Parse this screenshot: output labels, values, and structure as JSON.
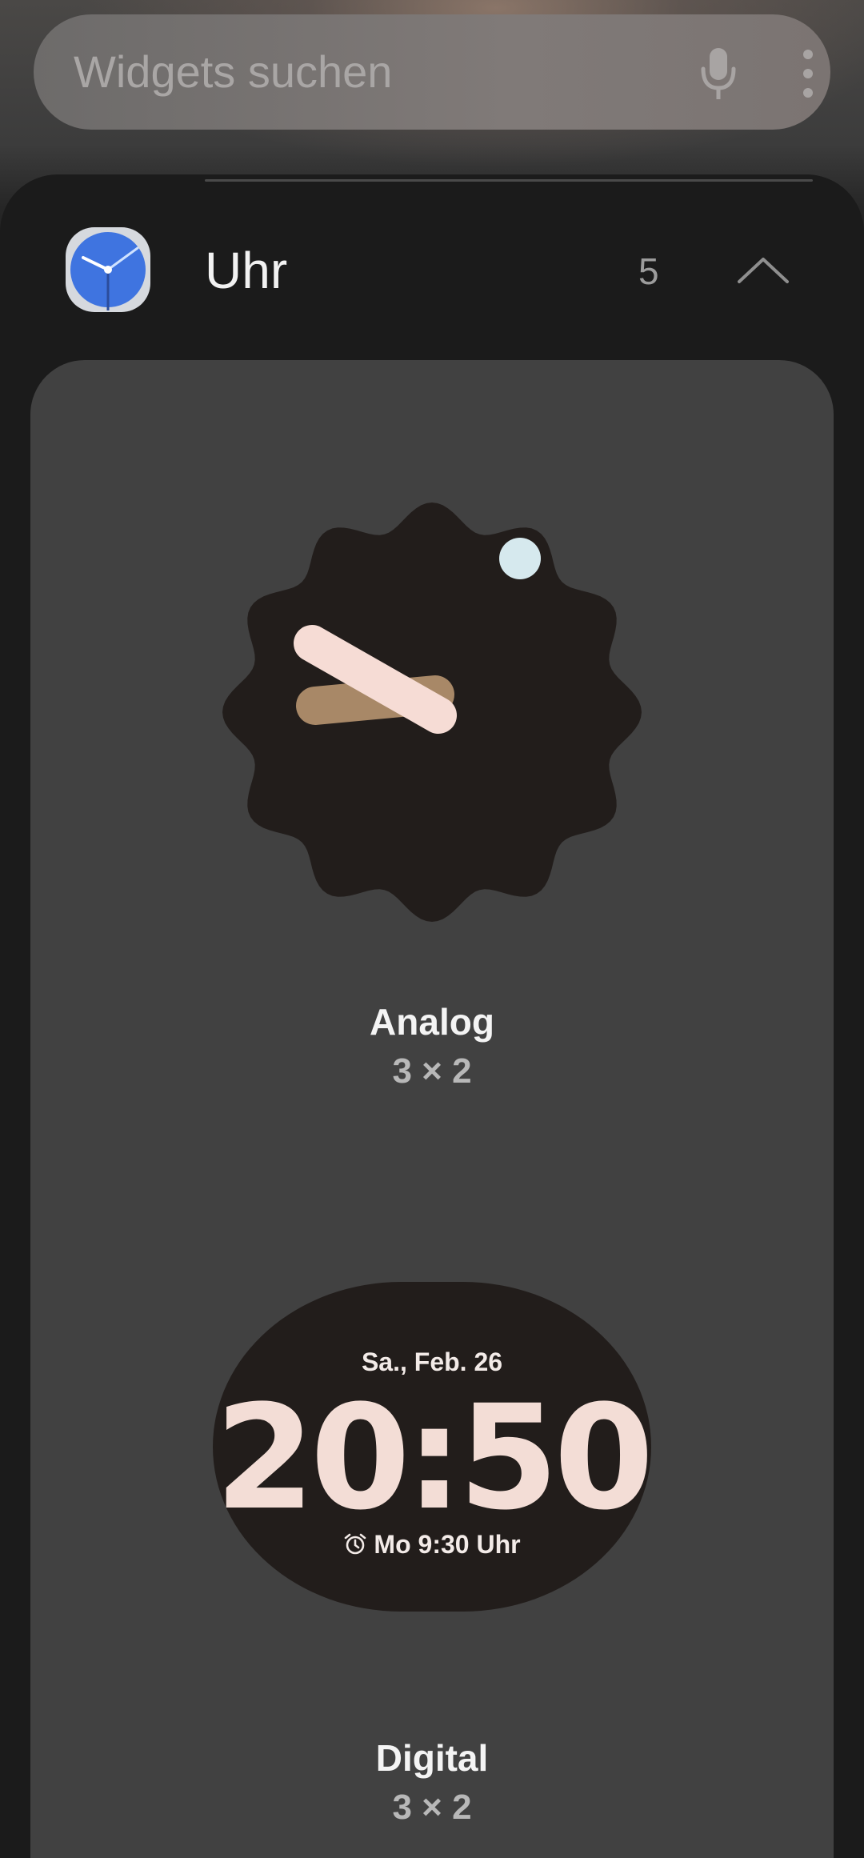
{
  "search": {
    "placeholder": "Widgets suchen",
    "icons": [
      "microphone-icon",
      "more-vert-icon"
    ]
  },
  "app": {
    "name": "Uhr",
    "widget_count": "5",
    "icon": "clock-app-icon",
    "collapse_icon": "chevron-up-icon"
  },
  "widgets": [
    {
      "title": "Analog",
      "size": "3 × 2",
      "preview": {
        "hour_hand_color": "#a88867",
        "minute_hand_color": "#f6dcd5",
        "second_dot_color": "#d6e9ee",
        "face_color": "#221d1b"
      }
    },
    {
      "title": "Digital",
      "size": "3 × 2",
      "preview": {
        "date": "Sa., Feb. 26",
        "time": "20:50",
        "alarm": "Mo 9:30 Uhr",
        "alarm_icon": "alarm-clock-icon"
      }
    }
  ],
  "colors": {
    "sheet_bg": "#1b1b1b",
    "card_bg": "#414141",
    "search_bg": "#777372",
    "time_color": "#f3ddd6"
  }
}
